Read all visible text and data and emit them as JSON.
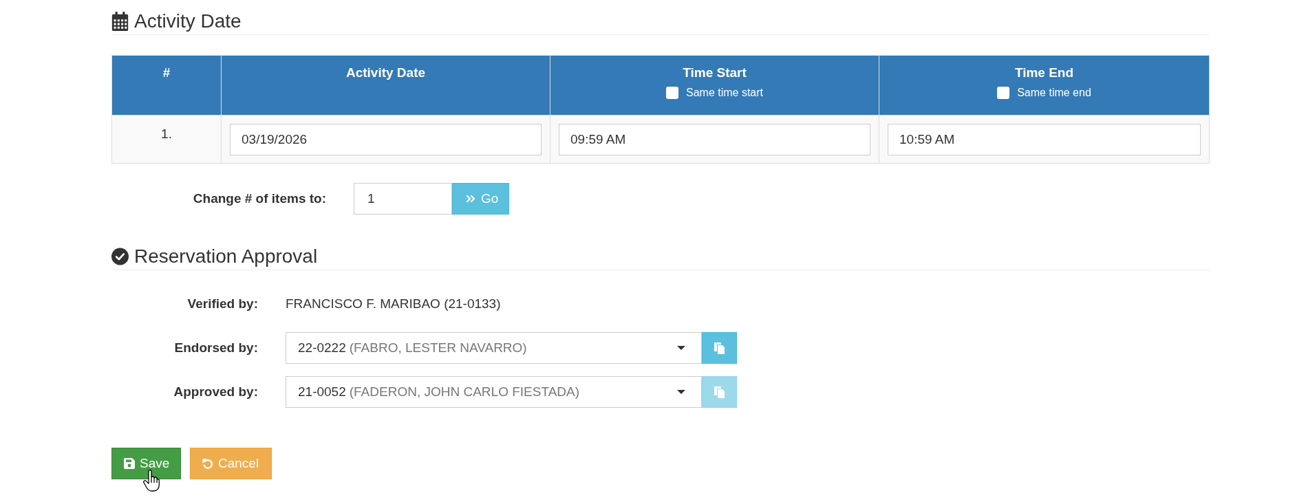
{
  "activity_section": {
    "title": "Activity Date"
  },
  "activity_table": {
    "columns": [
      {
        "label": "#"
      },
      {
        "label": "Activity Date"
      },
      {
        "label": "Time Start",
        "checkbox": {
          "label": "Same time start",
          "checked": false
        }
      },
      {
        "label": "Time End",
        "checkbox": {
          "label": "Same time end",
          "checked": false
        }
      }
    ],
    "rows": [
      {
        "cells": [
          {
            "kind": "number",
            "value": "1."
          },
          {
            "kind": "date",
            "value": "03/19/2026"
          },
          {
            "kind": "time",
            "value": "09:59 AM"
          },
          {
            "kind": "time",
            "value": "10:59 AM"
          }
        ]
      }
    ]
  },
  "item_count": {
    "label": "Change # of items to:",
    "value": "1",
    "button": "Go"
  },
  "approval_section": {
    "title": "Reservation Approval"
  },
  "approval_fields": [
    {
      "kind": "text",
      "label": "Verified by:",
      "value": "FRANCISCO F. MARIBAO (21-0133)"
    },
    {
      "kind": "select",
      "label": "Endorsed by:",
      "value": "22-0222",
      "value_detail": "(FABRO, LESTER NAVARRO)",
      "copy_button": {
        "disabled": false
      }
    },
    {
      "kind": "select",
      "label": "Approved by:",
      "value": "21-0052",
      "value_detail": "(FADERON, JOHN CARLO FIESTADA)",
      "copy_button": {
        "disabled": true
      }
    }
  ],
  "buttons": [
    {
      "kind": "save",
      "label": "Save"
    },
    {
      "kind": "cancel",
      "label": "Cancel"
    }
  ]
}
